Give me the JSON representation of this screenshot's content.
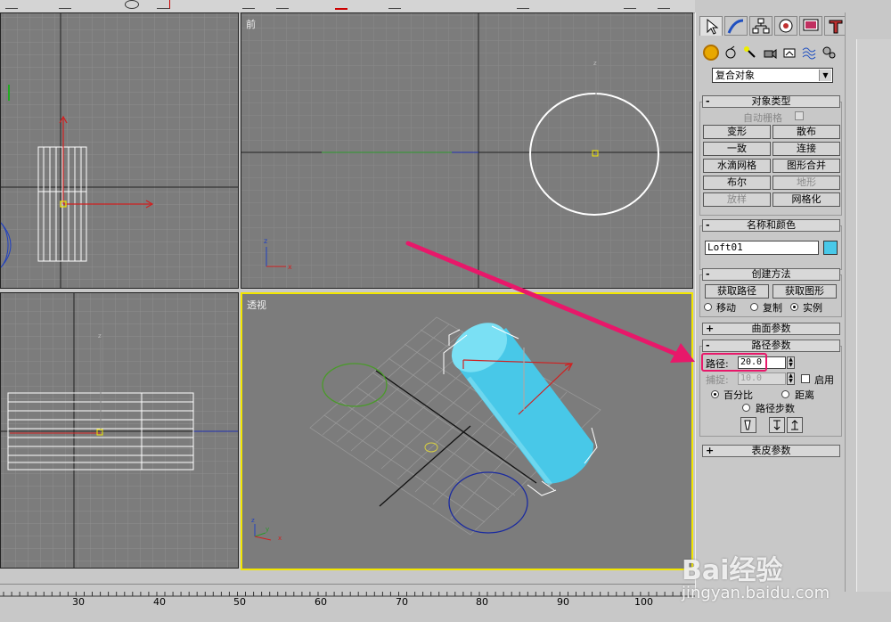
{
  "viewports": {
    "front_label": "前",
    "perspective_label": "透视"
  },
  "command_panel": {
    "tabs": [
      "create-tab",
      "modify-tab",
      "hierarchy-tab",
      "motion-tab",
      "display-tab",
      "utilities-tab"
    ],
    "category_icons": [
      "geometry-icon",
      "shapes-icon",
      "lights-icon",
      "cameras-icon",
      "helpers-icon",
      "spacewarps-icon",
      "systems-icon"
    ],
    "subcategory_dropdown": "复合对象",
    "object_type": {
      "header": "对象类型",
      "autogrid_label": "自动栅格",
      "buttons": [
        {
          "label": "变形",
          "enabled": true
        },
        {
          "label": "散布",
          "enabled": true
        },
        {
          "label": "一致",
          "enabled": true
        },
        {
          "label": "连接",
          "enabled": true
        },
        {
          "label": "水滴网格",
          "enabled": true
        },
        {
          "label": "图形合并",
          "enabled": true
        },
        {
          "label": "布尔",
          "enabled": true
        },
        {
          "label": "地形",
          "enabled": false
        },
        {
          "label": "放样",
          "enabled": false
        },
        {
          "label": "网格化",
          "enabled": true
        }
      ]
    },
    "name_color": {
      "header": "名称和颜色",
      "name_value": "Loft01",
      "color": "#48c8e8"
    },
    "creation_method": {
      "header": "创建方法",
      "get_path": "获取路径",
      "get_shape": "获取图形",
      "move": "移动",
      "copy": "复制",
      "instance": "实例",
      "selected": "实例"
    },
    "surface_params": {
      "header": "曲面参数",
      "sign": "+"
    },
    "path_params": {
      "header": "路径参数",
      "sign": "-",
      "path_label": "路径:",
      "path_value": "20.0",
      "snap_label": "捕捉:",
      "snap_value": "10.0",
      "enable_label": "启用",
      "percentage": "百分比",
      "distance": "距离",
      "path_steps": "路径步数",
      "selected": "百分比"
    },
    "skin_params": {
      "header": "表皮参数",
      "sign": "+"
    }
  },
  "ruler": {
    "labels": [
      "30",
      "40",
      "50",
      "60",
      "70",
      "80",
      "90",
      "100"
    ]
  },
  "watermark": {
    "brand": "Bai经验",
    "url": "jingyan.baidu.com"
  },
  "colors": {
    "viewport_bg": "#7c7c7c",
    "active_viewport_border": "#f2e600",
    "loft_object": "#48c8e8",
    "annotation_arrow": "#e8186a"
  }
}
